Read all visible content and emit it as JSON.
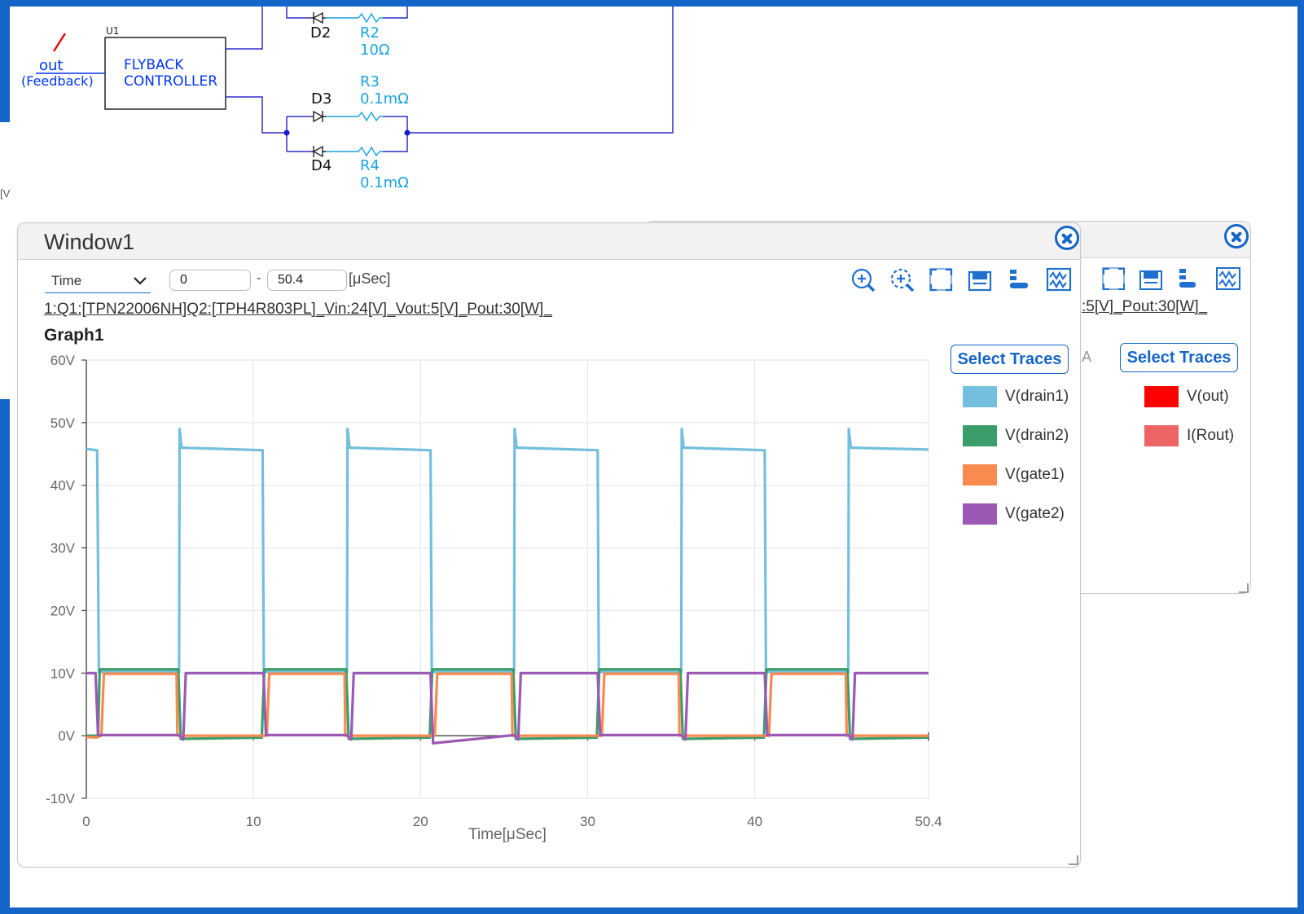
{
  "schematic": {
    "u1_ref": "U1",
    "controller_line1": "FLYBACK",
    "controller_line2": "CONTROLLER",
    "net_out": "out",
    "net_feedback": "(Feedback)",
    "d2": "D2",
    "r2": "R2",
    "r2_val": "10Ω",
    "d3": "D3",
    "r3": "R3",
    "r3_val": "0.1mΩ",
    "d4": "D4",
    "r4": "R4",
    "r4_val": "0.1mΩ"
  },
  "edge_text": "[V",
  "window1": {
    "title": "Window1",
    "x_axis_select": "Time",
    "range_start": "0",
    "range_end": "50.4",
    "range_unit": "[μSec]",
    "info_line": "1:Q1:[TPN22006NH]Q2:[TPH4R803PL]_Vin:24[V]_Vout:5[V]_Pout:30[W]_",
    "graph_title": "Graph1",
    "select_traces_label": "Select Traces",
    "toolbar_icons": [
      "zoom-in-icon",
      "zoom-area-icon",
      "fit-view-icon",
      "save-icon",
      "legend-settings-icon",
      "waveform-settings-icon"
    ]
  },
  "window2": {
    "info_fragment": ":5[V]_Pout:30[W]_",
    "partial_label": "A",
    "select_traces_label": "Select Traces",
    "legend": [
      {
        "name": "V(out)",
        "color": "#ff0000"
      },
      {
        "name": "I(Rout)",
        "color": "#ec6464"
      }
    ]
  },
  "chart_data": {
    "type": "line",
    "title": "Graph1",
    "xlabel": "Time[μSec]",
    "ylabel": "",
    "xlim": [
      0,
      50.4
    ],
    "ylim": [
      -10,
      60
    ],
    "x_ticks": [
      "0",
      "10",
      "20",
      "30",
      "40",
      "50.4"
    ],
    "y_ticks": [
      "60V",
      "50V",
      "40V",
      "30V",
      "20V",
      "10V",
      "0V",
      "-10V"
    ],
    "grid": true,
    "legend_position": "right",
    "series": [
      {
        "name": "V(drain1)",
        "color": "#74bfdd",
        "x": [
          0,
          0.65,
          0.75,
          5.55,
          5.58,
          5.7,
          5.82,
          10.55,
          10.62,
          10.7,
          15.6,
          15.63,
          15.75,
          15.87,
          20.6,
          20.67,
          20.75,
          25.6,
          25.63,
          25.75,
          25.87,
          30.6,
          30.67,
          30.75,
          35.6,
          35.63,
          35.75,
          35.87,
          40.6,
          40.67,
          40.75,
          45.6,
          45.63,
          45.75,
          45.87,
          50.4
        ],
        "y": [
          45.8,
          45.6,
          10.2,
          10.2,
          49,
          46,
          46,
          45.6,
          10.2,
          10.2,
          10.2,
          49,
          46,
          46,
          45.6,
          10.2,
          10.2,
          10.2,
          49,
          46,
          46,
          45.6,
          10.2,
          10.2,
          10.2,
          49,
          46,
          46,
          45.6,
          10.2,
          10.2,
          10.2,
          49,
          46,
          46,
          45.7
        ]
      },
      {
        "name": "V(drain2)",
        "color": "#3b9e6a",
        "x": [
          0,
          0.7,
          0.8,
          5.5,
          5.65,
          10.5,
          10.65,
          15.55,
          15.7,
          20.55,
          20.7,
          25.55,
          25.7,
          30.55,
          30.7,
          35.55,
          35.7,
          40.55,
          40.7,
          45.55,
          45.7,
          50.4
        ],
        "y": [
          0,
          0,
          10.6,
          10.6,
          -0.5,
          -0.3,
          10.6,
          10.6,
          -0.5,
          -0.3,
          10.6,
          10.6,
          -0.5,
          -0.3,
          10.6,
          10.6,
          -0.5,
          -0.3,
          10.6,
          10.6,
          -0.5,
          -0.3
        ]
      },
      {
        "name": "V(gate1)",
        "color": "#f98a50",
        "x": [
          0,
          0.6,
          0.9,
          1.05,
          5.4,
          5.45,
          10.5,
          10.8,
          10.95,
          15.45,
          15.5,
          20.55,
          20.85,
          21.0,
          25.45,
          25.5,
          30.55,
          30.85,
          31.0,
          35.45,
          35.5,
          40.55,
          40.85,
          41.0,
          45.45,
          45.5,
          50.4
        ],
        "y": [
          -0.2,
          -0.3,
          0,
          9.9,
          9.9,
          0,
          0,
          0,
          9.9,
          9.9,
          0,
          0,
          0,
          9.9,
          9.9,
          0,
          0,
          0,
          9.9,
          9.9,
          0,
          0,
          0,
          9.9,
          9.9,
          0,
          0
        ]
      },
      {
        "name": "V(gate2)",
        "color": "#9b59b6",
        "x": [
          0,
          0.55,
          0.7,
          5.55,
          5.8,
          5.95,
          10.6,
          10.75,
          15.6,
          15.85,
          16.0,
          20.6,
          20.75,
          25.6,
          25.85,
          26.0,
          30.6,
          30.75,
          35.6,
          35.85,
          36.0,
          40.6,
          40.75,
          45.6,
          45.85,
          46.0,
          50.4
        ],
        "y": [
          10,
          10,
          0.1,
          0.1,
          -0.6,
          10,
          10,
          0.1,
          0.1,
          -0.6,
          10,
          10,
          -1.2,
          0.1,
          -0.6,
          10,
          10,
          0.1,
          0.1,
          -0.6,
          10,
          10,
          0.1,
          0.1,
          -0.6,
          10,
          10
        ]
      }
    ]
  }
}
